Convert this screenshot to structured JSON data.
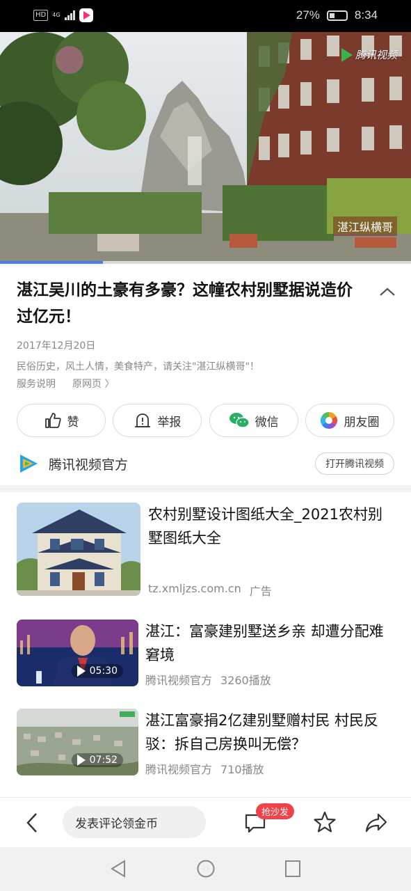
{
  "status_bar": {
    "hd": "HD",
    "network": "4G",
    "battery": "27%",
    "time": "8:34"
  },
  "video": {
    "watermark": "腾讯视频",
    "channel_tag": "湛江纵横哥",
    "progress": 0.25
  },
  "article": {
    "title": "湛江吴川的土豪有多豪？这幢农村别墅据说造价过亿元！",
    "date": "2017年12月20日",
    "description": "民俗历史，风土人情，美食特产，请关注\"湛江纵横哥\"！",
    "service_link": "服务说明",
    "original_link": "原网页 〉"
  },
  "actions": {
    "like": "赞",
    "report": "举报",
    "wechat": "微信",
    "moments": "朋友圈"
  },
  "source": {
    "name": "腾讯视频官方",
    "open_button": "打开腾讯视频"
  },
  "feed": [
    {
      "title": "农村别墅设计图纸大全_2021农村别墅图纸大全",
      "source": "tz.xmljzs.com.cn",
      "label": "广告"
    },
    {
      "title": "湛江：富豪建别墅送乡亲 却遭分配难窘境",
      "source": "腾讯视频官方",
      "plays": "3260播放",
      "duration": "05:30"
    },
    {
      "title": "湛江富豪捐2亿建别墅赠村民 村民反驳：拆自己房换叫无偿？",
      "source": "腾讯视频官方",
      "plays": "710播放",
      "duration": "07:52"
    }
  ],
  "bottom_bar": {
    "comment_placeholder": "发表评论领金币",
    "comment_badge": "抢沙发"
  },
  "colors": {
    "accent_blue": "#4a7cf0",
    "badge_red": "#f0424b",
    "wechat_green": "#2aae67"
  }
}
